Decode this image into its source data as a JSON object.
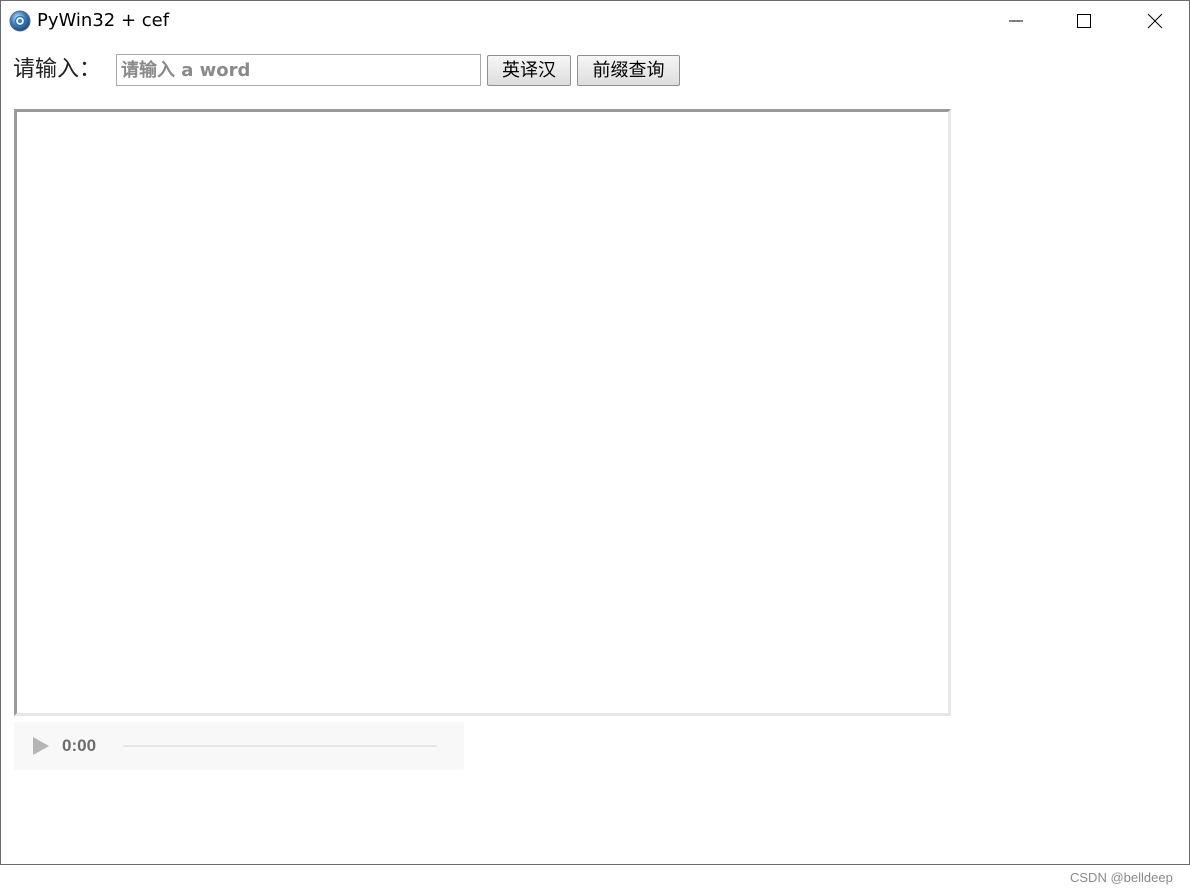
{
  "window": {
    "title": "PyWin32 + cef",
    "app_icon": "globe-icon",
    "controls": [
      "minimize-icon",
      "maximize-icon",
      "close-icon"
    ]
  },
  "form": {
    "prompt_label": "请输入：",
    "input_value": "",
    "input_placeholder": "请输入 a word",
    "translate_button_label": "英译汉",
    "prefix_button_label": "前缀查询"
  },
  "result": {
    "content": ""
  },
  "audio": {
    "play_icon": "play-icon",
    "time": "0:00",
    "progress": 0
  },
  "watermark": "CSDN @belldeep",
  "colors": {
    "accent": "#2b6cb0",
    "border": "#9b9b9b"
  }
}
